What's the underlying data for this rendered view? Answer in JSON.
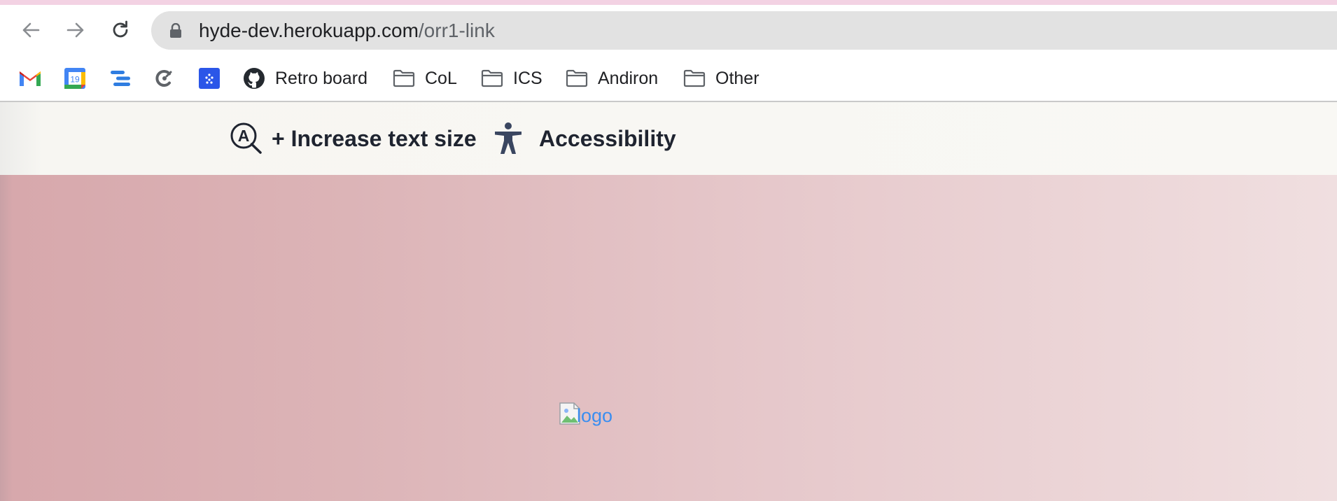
{
  "browser": {
    "url_host": "hyde-dev.herokuapp.com",
    "url_path": "/orr1-link",
    "icons": [
      "back-arrow-icon",
      "forward-arrow-icon",
      "reload-icon",
      "lock-icon"
    ]
  },
  "bookmarks": [
    {
      "label": "",
      "icon": "gmail-icon"
    },
    {
      "label": "",
      "icon": "calendar-icon",
      "badge": "19"
    },
    {
      "label": "",
      "icon": "tasks-icon"
    },
    {
      "label": "",
      "icon": "clockify-icon"
    },
    {
      "label": "",
      "icon": "app-icon"
    },
    {
      "label": "Retro board",
      "icon": "github-icon"
    },
    {
      "label": "CoL",
      "icon": "folder-icon"
    },
    {
      "label": "ICS",
      "icon": "folder-icon"
    },
    {
      "label": "Andiron",
      "icon": "folder-icon"
    },
    {
      "label": "Other",
      "icon": "folder-icon"
    }
  ],
  "toolbar": {
    "increase_text": "+ Increase text size",
    "accessibility": "Accessibility"
  },
  "content": {
    "logo_alt": "logo"
  },
  "colors": {
    "link_blue": "#3b8ef0",
    "toolbar_text": "#1f2430",
    "accessibility_icon": "#3a4660"
  }
}
